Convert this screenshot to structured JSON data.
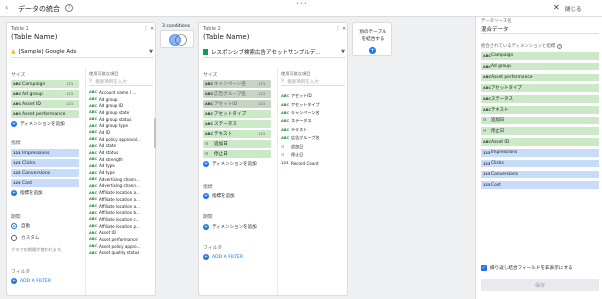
{
  "topbar": {
    "title": "データの統合",
    "help": "?",
    "close_label": "閉じる"
  },
  "table1": {
    "label": "Table 1",
    "name": "(Table Name)",
    "source": "[Sample] Google Ads",
    "dimensions_label": "サイズ",
    "dimensions": [
      {
        "type": "ABC",
        "name": "Campaign",
        "count": "123"
      },
      {
        "type": "ABC",
        "name": "Ad group",
        "count": "123"
      },
      {
        "type": "ABC",
        "name": "Asset ID",
        "count": "123"
      },
      {
        "type": "ABC",
        "name": "Asset performance",
        "count": ""
      }
    ],
    "add_dimension": "ディメンションを追加",
    "metrics_label": "指標",
    "metrics": [
      {
        "type": "123",
        "name": "Impressions"
      },
      {
        "type": "123",
        "name": "Clicks"
      },
      {
        "type": "123",
        "name": "Conversions"
      },
      {
        "type": "123",
        "name": "Cost"
      }
    ],
    "add_metric": "指標を追加",
    "period_label": "期間",
    "period_auto": "自動",
    "period_custom": "カスタム",
    "period_note": "グラフの期間が使われます。",
    "filter_label": "フィルタ",
    "add_filter": "ADD A FILTER",
    "available_label": "使用可能な項目",
    "search_placeholder": "検索項目を入力",
    "fields": [
      {
        "type": "ABC",
        "name": "Account name / ..."
      },
      {
        "type": "ABC",
        "name": "Ad group"
      },
      {
        "type": "ABC",
        "name": "Ad group ID"
      },
      {
        "type": "ABC",
        "name": "Ad group state"
      },
      {
        "type": "ABC",
        "name": "Ad group status"
      },
      {
        "type": "ABC",
        "name": "Ad group type"
      },
      {
        "type": "ABC",
        "name": "Ad ID"
      },
      {
        "type": "ABC",
        "name": "Ad policy approval..."
      },
      {
        "type": "ABC",
        "name": "Ad state"
      },
      {
        "type": "ABC",
        "name": "Ad status"
      },
      {
        "type": "ABC",
        "name": "Ad strength"
      },
      {
        "type": "ABC",
        "name": "Ad type"
      },
      {
        "type": "ABC",
        "name": "Ad type"
      },
      {
        "type": "ABC",
        "name": "Advertising chann..."
      },
      {
        "type": "ABC",
        "name": "Advertising chann..."
      },
      {
        "type": "ABC",
        "name": "Affiliate location a..."
      },
      {
        "type": "ABC",
        "name": "Affiliate location a..."
      },
      {
        "type": "ABC",
        "name": "Affiliate location a..."
      },
      {
        "type": "ABC",
        "name": "Affiliate location b..."
      },
      {
        "type": "ABC",
        "name": "Affiliate location c..."
      },
      {
        "type": "ABC",
        "name": "Affiliate location p..."
      },
      {
        "type": "ABC",
        "name": "Asset ID"
      },
      {
        "type": "ABC",
        "name": "Asset performance"
      },
      {
        "type": "ABC",
        "name": "Asset policy appro..."
      },
      {
        "type": "ABC",
        "name": "Asset quality status"
      }
    ]
  },
  "join": {
    "label": "3 conditions"
  },
  "table2": {
    "label": "Table 2",
    "name": "(Table Name)",
    "source": "レスポンシブ検索広告アセットサンプルデ...",
    "dimensions_label": "サイズ",
    "dimensions": [
      {
        "type": "ABC",
        "name": "キャンペーン名",
        "count": "123",
        "dim": true
      },
      {
        "type": "ABC",
        "name": "広告グループ名",
        "count": "123",
        "dim": true
      },
      {
        "type": "ABC",
        "name": "アセットID",
        "count": "123",
        "dim": true
      },
      {
        "type": "ABC",
        "name": "アセットタイプ",
        "count": "",
        "dim": false
      },
      {
        "type": "ABC",
        "name": "ステータス",
        "count": "",
        "dim": false
      },
      {
        "type": "ABC",
        "name": "テキスト",
        "count": "123",
        "dim": false
      },
      {
        "type": "☷",
        "name": "追加日",
        "count": "",
        "dim": false
      },
      {
        "type": "☷",
        "name": "停止日",
        "count": "",
        "dim": false
      }
    ],
    "add_dimension": "ディメンションを追加",
    "metrics_label": "指標",
    "add_metric": "指標を追加",
    "period_label": "期間",
    "add_period": "ディメンションを追加",
    "filter_label": "フィルタ",
    "add_filter": "ADD A FILTER",
    "available_label": "使用可能な項目",
    "search_placeholder": "検索項目を入力",
    "fields": [
      {
        "type": "ABC",
        "name": "アセットID"
      },
      {
        "type": "ABC",
        "name": "アセットタイプ"
      },
      {
        "type": "ABC",
        "name": "キャンペーン名"
      },
      {
        "type": "ABC",
        "name": "ステータス"
      },
      {
        "type": "ABC",
        "name": "テキスト"
      },
      {
        "type": "ABC",
        "name": "広告グループ名"
      },
      {
        "type": "☷",
        "name": "追加日"
      },
      {
        "type": "☷",
        "name": "停止日"
      },
      {
        "type": "123",
        "name": "Record Count"
      }
    ]
  },
  "add_table": {
    "line1": "別のテーブル",
    "line2": "を結合する"
  },
  "side_panel": {
    "name_label": "データソース名",
    "name_value": "混合データ",
    "fields_label": "統合されているディメンションと指標",
    "fields": [
      {
        "type": "ABC",
        "name": "Campaign",
        "kind": "dim"
      },
      {
        "type": "ABC",
        "name": "Ad group",
        "kind": "dim"
      },
      {
        "type": "ABC",
        "name": "Asset performance",
        "kind": "dim"
      },
      {
        "type": "ABC",
        "name": "アセットタイプ",
        "kind": "dim"
      },
      {
        "type": "ABC",
        "name": "ステータス",
        "kind": "dim"
      },
      {
        "type": "ABC",
        "name": "テキスト",
        "kind": "dim"
      },
      {
        "type": "☷",
        "name": "追加日",
        "kind": "dim"
      },
      {
        "type": "☷",
        "name": "停止日",
        "kind": "dim"
      },
      {
        "type": "ABC",
        "name": "Asset ID",
        "kind": "dim"
      },
      {
        "type": "123",
        "name": "Impressions",
        "kind": "metric"
      },
      {
        "type": "123",
        "name": "Clicks",
        "kind": "metric"
      },
      {
        "type": "123",
        "name": "Conversions",
        "kind": "metric"
      },
      {
        "type": "123",
        "name": "Cost",
        "kind": "metric"
      }
    ],
    "repeat_checkbox": "繰り返し結合フィールドを非表示にする",
    "save_label": "保存"
  }
}
